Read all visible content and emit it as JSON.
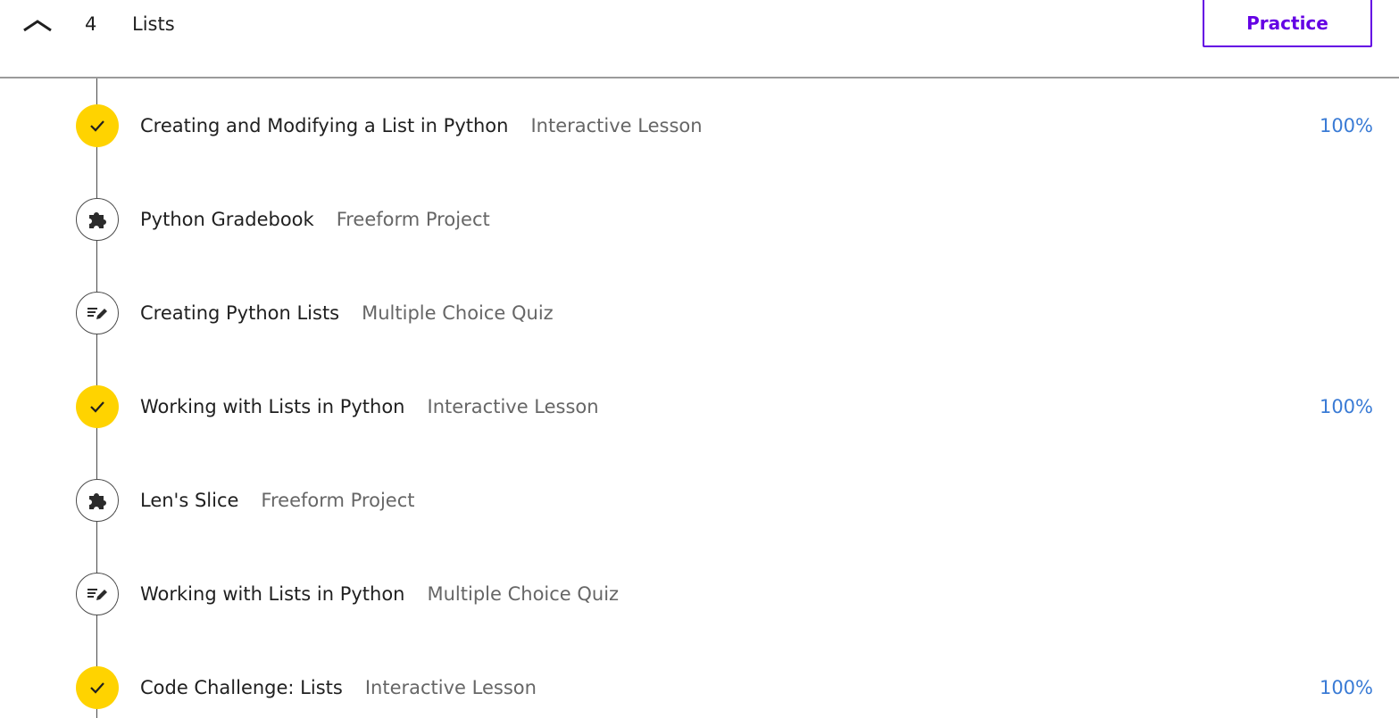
{
  "module": {
    "number": "4",
    "title": "Lists",
    "collapse_icon": "chevron-up-icon",
    "practice_label": "Practice",
    "accent_color": "#6400e4"
  },
  "lessons": [
    {
      "title": "Creating and Modifying a List in Python",
      "type": "Interactive Lesson",
      "status": "complete",
      "icon": "check-icon",
      "progress": "100%"
    },
    {
      "title": "Python Gradebook",
      "type": "Freeform Project",
      "status": "incomplete",
      "icon": "puzzle-icon",
      "progress": ""
    },
    {
      "title": "Creating Python Lists",
      "type": "Multiple Choice Quiz",
      "status": "incomplete",
      "icon": "quiz-pencil-icon",
      "progress": ""
    },
    {
      "title": "Working with Lists in Python",
      "type": "Interactive Lesson",
      "status": "complete",
      "icon": "check-icon",
      "progress": "100%"
    },
    {
      "title": "Len's Slice",
      "type": "Freeform Project",
      "status": "incomplete",
      "icon": "puzzle-icon",
      "progress": ""
    },
    {
      "title": "Working with Lists in Python",
      "type": "Multiple Choice Quiz",
      "status": "incomplete",
      "icon": "quiz-pencil-icon",
      "progress": ""
    },
    {
      "title": "Code Challenge: Lists",
      "type": "Interactive Lesson",
      "status": "complete",
      "icon": "check-icon",
      "progress": "100%"
    }
  ],
  "colors": {
    "complete": "#ffd300",
    "progress_text": "#3a7bd5",
    "type_text": "#666666"
  }
}
